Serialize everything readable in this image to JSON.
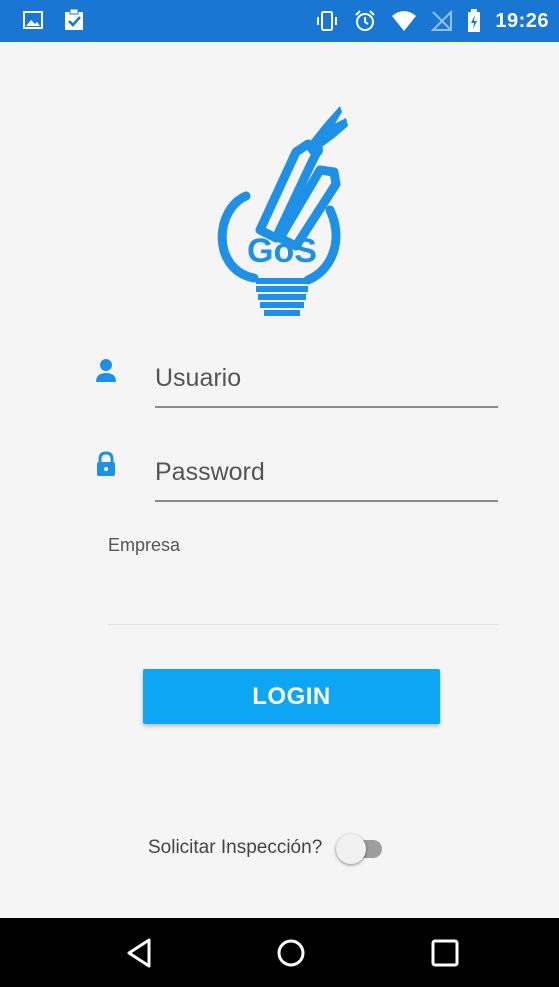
{
  "status_bar": {
    "time": "19:26",
    "left_icons": [
      "image-icon",
      "clipboard-check-icon"
    ],
    "right_icons": [
      "vibrate-icon",
      "alarm-icon",
      "wifi-icon",
      "no-sim-icon",
      "battery-icon"
    ],
    "background": "#1976d2"
  },
  "logo": {
    "text": "GoS",
    "color": "#1e90e6"
  },
  "login_form": {
    "username_placeholder": "Usuario",
    "password_placeholder": "Password",
    "company_label": "Empresa",
    "login_button": "LOGIN",
    "accent_color": "#0da6f5"
  },
  "inspection": {
    "label": "Solicitar Inspección?",
    "enabled": false
  },
  "nav_bar": {
    "buttons": [
      "back-icon",
      "home-icon",
      "recents-icon"
    ]
  }
}
